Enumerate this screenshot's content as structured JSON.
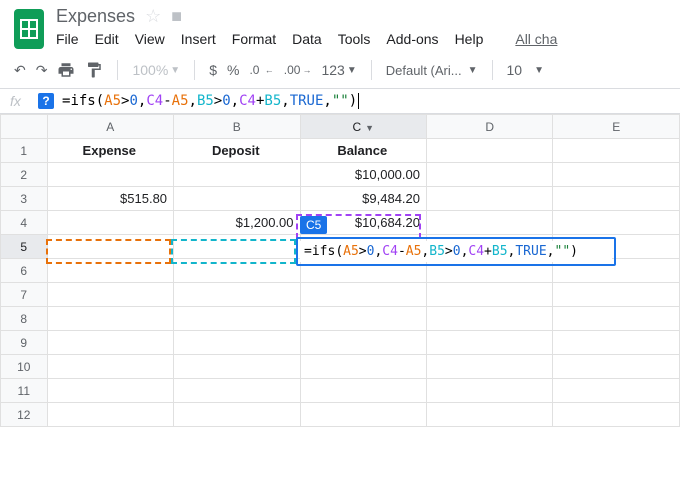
{
  "doc": {
    "title": "Expenses"
  },
  "menu": {
    "file": "File",
    "edit": "Edit",
    "view": "View",
    "insert": "Insert",
    "format": "Format",
    "data": "Data",
    "tools": "Tools",
    "addons": "Add-ons",
    "help": "Help",
    "allcha": "All cha"
  },
  "toolbar": {
    "zoom": "100%",
    "currency": "$",
    "percent": "%",
    "dec_less": ".0",
    "dec_more": ".00",
    "numfmt": "123",
    "font": "Default (Ari...",
    "font_size": "10"
  },
  "formula_bar": {
    "help": "?",
    "prefix": "=",
    "fn": "ifs",
    "open": "(",
    "a5": "A5",
    "gt1": ">",
    "zero1": "0",
    "comma": ",",
    "c4": "C4",
    "minus": "-",
    "a5b": "A5",
    "b5": "B5",
    "gt2": ">",
    "zero2": "0",
    "c4b": "C4",
    "plus": "+",
    "b5b": "B5",
    "true": "TRUE",
    "str": "\"\"",
    "close": ")"
  },
  "columns": [
    "A",
    "B",
    "C",
    "D",
    "E"
  ],
  "rows": [
    "1",
    "2",
    "3",
    "4",
    "5",
    "6",
    "7",
    "8",
    "9",
    "10",
    "11",
    "12"
  ],
  "cells": {
    "A1": "Expense",
    "B1": "Deposit",
    "C1": "Balance",
    "C2": "$10,000.00",
    "A3": "$515.80",
    "C3": "$9,484.20",
    "B4": "$1,200.00",
    "C4": "$10,684.20"
  },
  "active": {
    "name_tab": "C5",
    "edit_text": "=ifs(A5>0,C4-A5,B5>0,C4+B5,TRUE,\"\")"
  }
}
